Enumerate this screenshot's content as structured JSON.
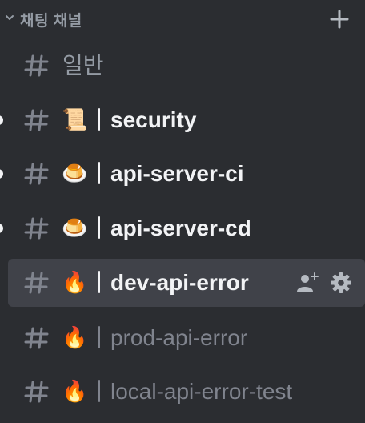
{
  "category": {
    "label": "채팅 채널",
    "collapse_icon": "chevron-down-icon",
    "add_icon": "plus-icon"
  },
  "channels": [
    {
      "name": "일반",
      "emoji": ""
    },
    {
      "name": "security",
      "emoji": "📜"
    },
    {
      "name": "api-server-ci",
      "emoji": "🍮"
    },
    {
      "name": "api-server-cd",
      "emoji": "🍮"
    },
    {
      "name": "dev-api-error",
      "emoji": "🔥"
    },
    {
      "name": "prod-api-error",
      "emoji": "🔥"
    },
    {
      "name": "local-api-error-test",
      "emoji": "🔥"
    }
  ],
  "colors": {
    "background": "#2b2d31",
    "active_row": "#404249",
    "text_bright": "#f2f3f5",
    "text_muted": "#80848e",
    "category_text": "#949ba4"
  }
}
